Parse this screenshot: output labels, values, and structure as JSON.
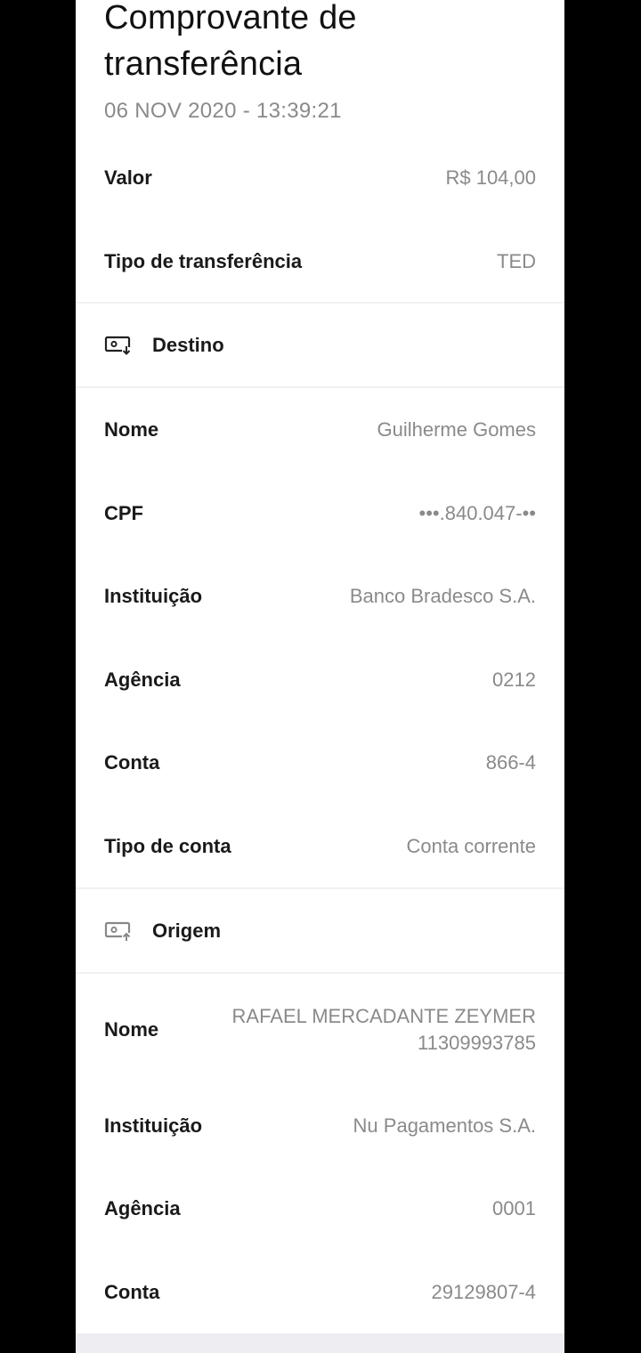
{
  "header": {
    "title": "Comprovante de\ntransferência",
    "timestamp": "06 NOV 2020 - 13:39:21"
  },
  "summary": {
    "valor_label": "Valor",
    "valor_value": "R$ 104,00",
    "tipo_label": "Tipo de transferência",
    "tipo_value": "TED"
  },
  "destino": {
    "section_label": "Destino",
    "icon": "money-in-icon",
    "rows": [
      {
        "label": "Nome",
        "value": "Guilherme Gomes"
      },
      {
        "label": "CPF",
        "value": "•••.840.047-••"
      },
      {
        "label": "Instituição",
        "value": "Banco Bradesco S.A."
      },
      {
        "label": "Agência",
        "value": "0212"
      },
      {
        "label": "Conta",
        "value": "866-4"
      },
      {
        "label": "Tipo de conta",
        "value": "Conta corrente"
      }
    ]
  },
  "origem": {
    "section_label": "Origem",
    "icon": "money-out-icon",
    "rows": [
      {
        "label": "Nome",
        "value": "RAFAEL MERCADANTE ZEYMER\n11309993785"
      },
      {
        "label": "Instituição",
        "value": "Nu Pagamentos S.A."
      },
      {
        "label": "Agência",
        "value": "0001"
      },
      {
        "label": "Conta",
        "value": "29129807-4"
      }
    ]
  }
}
